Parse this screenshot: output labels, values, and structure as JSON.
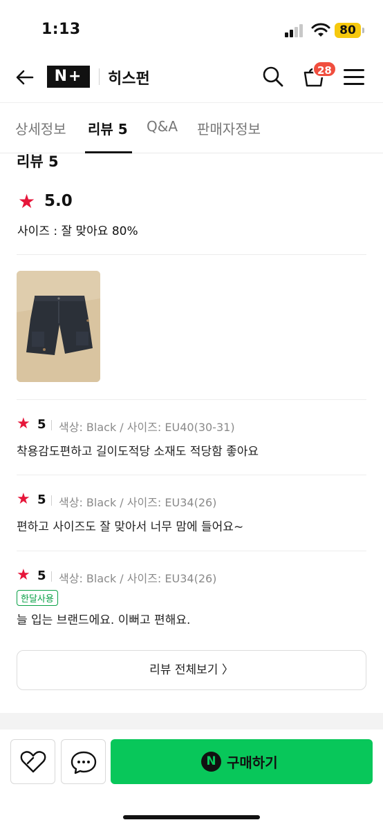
{
  "status": {
    "time": "1:13",
    "battery": "80"
  },
  "header": {
    "logo_text": "N+",
    "shop_name": "히스펀",
    "cart_count": "28"
  },
  "tabs": [
    {
      "label": "상세정보",
      "active": false
    },
    {
      "label": "리뷰 5",
      "active": true
    },
    {
      "label": "Q&A",
      "active": false
    },
    {
      "label": "판매자정보",
      "active": false
    }
  ],
  "review_section": {
    "title": "리뷰 5",
    "star": "★",
    "rating": "5.0",
    "size_summary": "사이즈 : 잘 맞아요 80%",
    "thumbnail_alt": "black shorts photo"
  },
  "reviews": [
    {
      "score": "5",
      "options": "색상: Black / 사이즈: EU40(30-31)",
      "badge": "",
      "text": "착용감도편하고 길이도적당 소재도 적당함 좋아요"
    },
    {
      "score": "5",
      "options": "색상: Black / 사이즈: EU34(26)",
      "badge": "",
      "text": "편하고 사이즈도 잘 맞아서 너무 맘에 들어요~"
    },
    {
      "score": "5",
      "options": "색상: Black / 사이즈: EU34(26)",
      "badge": "한달사용",
      "text": "늘 입는 브랜드에요. 이뻐고 편해요."
    }
  ],
  "all_reviews_label": "리뷰 전체보기 〉",
  "bottom_bar": {
    "buy_icon": "N",
    "buy_label": "구매하기"
  },
  "colors": {
    "accent_green": "#08c75a",
    "star_red": "#e6163a",
    "badge_red": "#f04e3e"
  },
  "icons": [
    "back-arrow-icon",
    "search-icon",
    "shopping-bag-icon",
    "hamburger-menu-icon",
    "heart-icon",
    "chat-icon",
    "star-icon"
  ]
}
